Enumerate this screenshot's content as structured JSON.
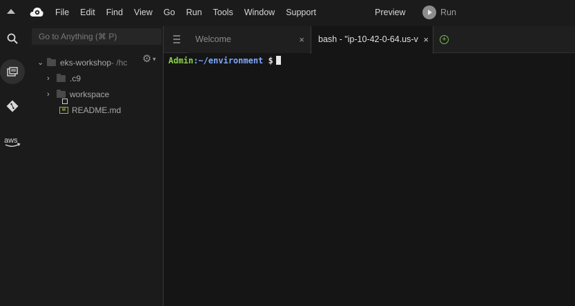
{
  "menubar": {
    "items": [
      "File",
      "Edit",
      "Find",
      "View",
      "Go",
      "Run",
      "Tools",
      "Window",
      "Support"
    ],
    "preview_label": "Preview",
    "run_label": "Run"
  },
  "activitybar": {
    "aws_label": "aws"
  },
  "sidebar": {
    "goto_placeholder": "Go to Anything (⌘ P)",
    "tree": [
      {
        "name": "eks-workshop",
        "suffix": " - /hc"
      },
      {
        "name": ".c9"
      },
      {
        "name": "workspace"
      },
      {
        "name": "README.md"
      }
    ]
  },
  "tabs": [
    {
      "label": "Welcome",
      "active": false
    },
    {
      "label": "bash - \"ip-10-42-0-64.us-v",
      "active": true
    }
  ],
  "terminal": {
    "user": "Admin",
    "path": ":~/environment",
    "symbol": " $"
  },
  "colors": {
    "prompt_user": "#8ad04b",
    "prompt_path": "#7fa8ff",
    "add_tab": "#7bbf4f",
    "md_icon": "#9bb34a"
  }
}
